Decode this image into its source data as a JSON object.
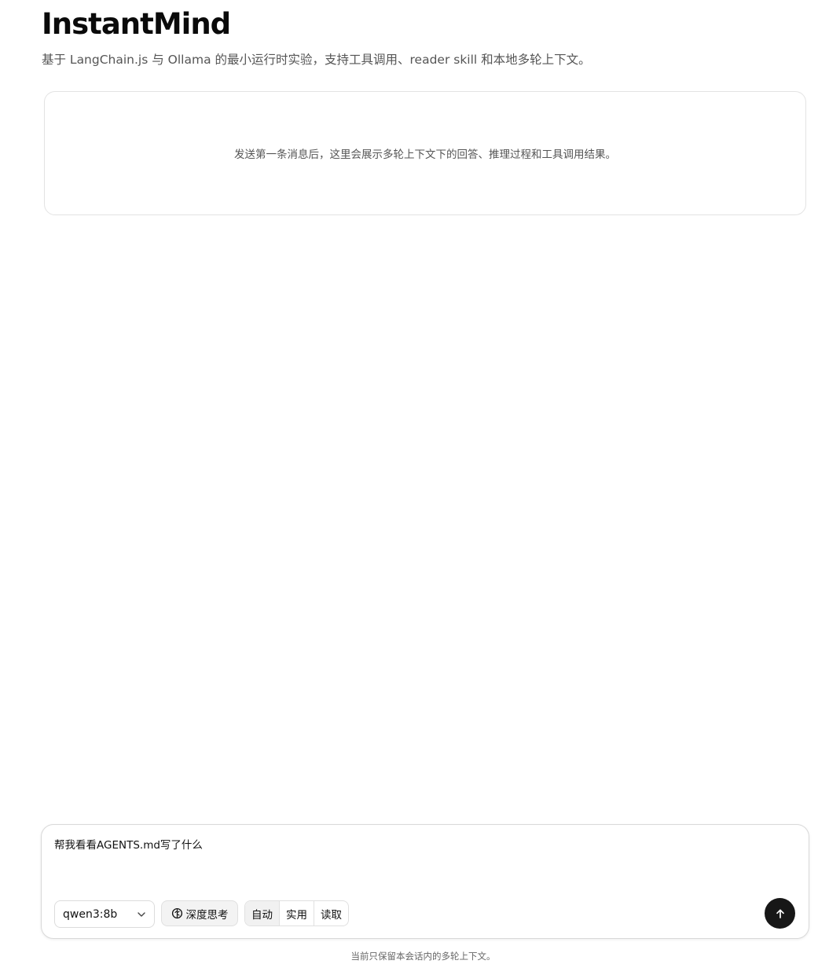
{
  "header": {
    "title": "InstantMind",
    "subtitle": "基于 LangChain.js 与 Ollama 的最小运行时实验，支持工具调用、reader skill 和本地多轮上下文。"
  },
  "messages": {
    "empty_hint": "发送第一条消息后，这里会展示多轮上下文下的回答、推理过程和工具调用结果。"
  },
  "composer": {
    "input_value": "帮我看看AGENTS.md写了什么",
    "model_selected": "qwen3:8b",
    "think_label": "深度思考",
    "modes": [
      {
        "label": "自动",
        "active": true
      },
      {
        "label": "实用",
        "active": false
      },
      {
        "label": "读取",
        "active": false
      }
    ]
  },
  "footer": {
    "note": "当前只保留本会话内的多轮上下文。"
  },
  "colors": {
    "send_button_bg": "#171717",
    "border": "#e3e3e3",
    "muted_text": "#555555"
  }
}
